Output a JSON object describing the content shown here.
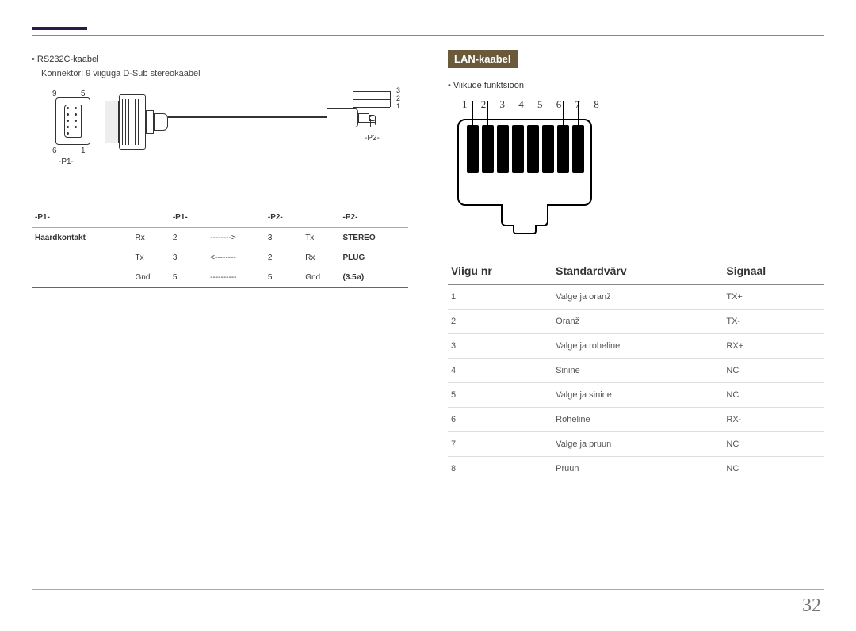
{
  "page_number": "32",
  "left": {
    "bullet": "RS232C-kaabel",
    "subtext": "Konnektor: 9 viiguga D-Sub stereokaabel",
    "diagram_labels": {
      "n9": "9",
      "n5": "5",
      "n6": "6",
      "n1": "1",
      "p1": "-P1-",
      "p2": "-P2-",
      "j3": "3",
      "j2": "2",
      "j1": "1"
    },
    "rs232_headers": [
      "-P1-",
      "",
      "-P1-",
      "",
      "-P2-",
      "",
      "-P2-"
    ],
    "rs232_rows": [
      [
        "Haardkontakt",
        "Rx",
        "2",
        "-------->",
        "3",
        "Tx",
        "STEREO"
      ],
      [
        "",
        "Tx",
        "3",
        "<--------",
        "2",
        "Rx",
        "PLUG"
      ],
      [
        "",
        "Gnd",
        "5",
        "----------",
        "5",
        "Gnd",
        "(3.5ø)"
      ]
    ]
  },
  "right": {
    "section_title": "LAN-kaabel",
    "bullet": "Viikude funktsioon",
    "pin_numbers": "1 2 3 4 5 6 7 8",
    "lan_headers": [
      "Viigu nr",
      "Standardvärv",
      "Signaal"
    ],
    "lan_rows": [
      [
        "1",
        "Valge ja oranž",
        "TX+"
      ],
      [
        "2",
        "Oranž",
        "TX-"
      ],
      [
        "3",
        "Valge ja roheline",
        "RX+"
      ],
      [
        "4",
        "Sinine",
        "NC"
      ],
      [
        "5",
        "Valge ja sinine",
        "NC"
      ],
      [
        "6",
        "Roheline",
        "RX-"
      ],
      [
        "7",
        "Valge ja pruun",
        "NC"
      ],
      [
        "8",
        "Pruun",
        "NC"
      ]
    ]
  }
}
